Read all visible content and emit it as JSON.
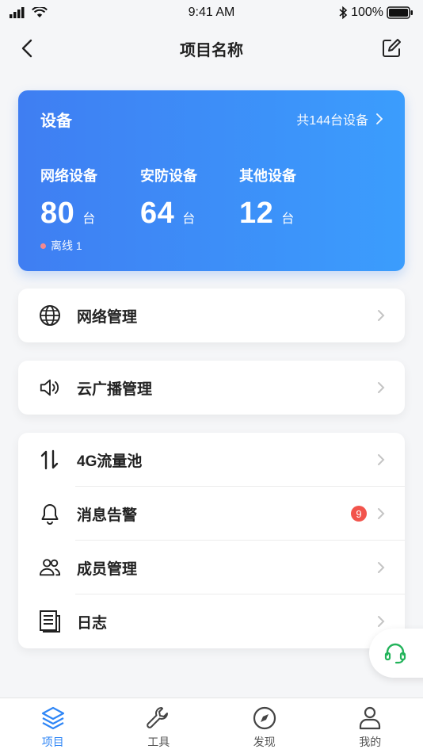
{
  "status": {
    "time": "9:41 AM",
    "battery": "100%"
  },
  "nav": {
    "title": "项目名称"
  },
  "device_card": {
    "title": "设备",
    "total": "共144台设备",
    "groups": [
      {
        "label": "网络设备",
        "value": "80",
        "unit": "台"
      },
      {
        "label": "安防设备",
        "value": "64",
        "unit": "台"
      },
      {
        "label": "其他设备",
        "value": "12",
        "unit": "台"
      }
    ],
    "offline": "离线 1"
  },
  "menu": {
    "network": "网络管理",
    "broadcast": "云广播管理",
    "traffic": "4G流量池",
    "alerts": "消息告警",
    "alerts_badge": "9",
    "members": "成员管理",
    "logs": "日志"
  },
  "tabs": [
    {
      "label": "项目"
    },
    {
      "label": "工具"
    },
    {
      "label": "发现"
    },
    {
      "label": "我的"
    }
  ],
  "colors": {
    "accent": "#2f86f6",
    "badge": "#f2544c",
    "support": "#22b35a"
  }
}
